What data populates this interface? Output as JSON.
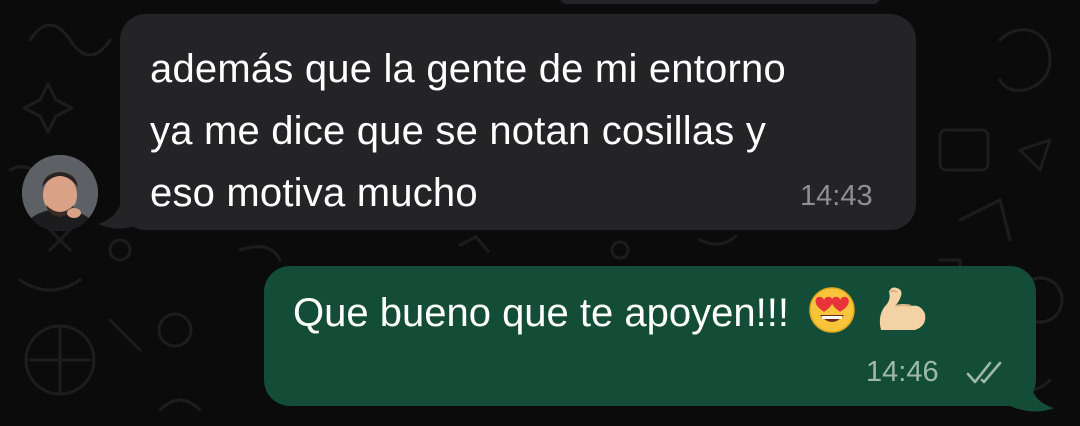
{
  "chat": {
    "incoming": {
      "lines": [
        "además que la gente de mi entorno",
        "ya me dice que se notan cosillas y",
        "eso motiva mucho"
      ],
      "time": "14:43"
    },
    "outgoing": {
      "text": "Que bueno que te apoyen!!!",
      "emojis": [
        "heart-eyes-emoji",
        "flexed-biceps-emoji"
      ],
      "time": "14:46",
      "status": "read"
    }
  },
  "colors": {
    "background": "#0b0b0b",
    "incoming_bubble": "#242426",
    "outgoing_bubble": "#144d37",
    "timestamp_in": "#8e8e93",
    "timestamp_out": "#9fb8ac"
  },
  "icons": [
    "wallpaper-doodle-pattern",
    "double-check-icon"
  ]
}
